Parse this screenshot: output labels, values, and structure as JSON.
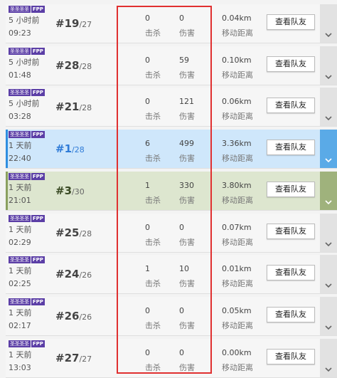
{
  "matches": [
    {
      "badge1": "圣圣圣圣",
      "badge2": "FPP",
      "time_ago": "5 小时前",
      "time": "09:23",
      "rank": "#19",
      "total": "/27",
      "kills": "0",
      "kills_label": "击杀",
      "damage": "0",
      "damage_label": "伤害",
      "distance": "0.04km",
      "distance_label": "移动距离",
      "button_label": "查看队友",
      "style": "normal"
    },
    {
      "badge1": "圣圣圣圣",
      "badge2": "FPP",
      "time_ago": "5 小时前",
      "time": "01:48",
      "rank": "#28",
      "total": "/28",
      "kills": "0",
      "kills_label": "击杀",
      "damage": "59",
      "damage_label": "伤害",
      "distance": "0.10km",
      "distance_label": "移动距离",
      "button_label": "查看队友",
      "style": "normal"
    },
    {
      "badge1": "圣圣圣圣",
      "badge2": "FPP",
      "time_ago": "5 小时前",
      "time": "03:28",
      "rank": "#21",
      "total": "/28",
      "kills": "0",
      "kills_label": "击杀",
      "damage": "121",
      "damage_label": "伤害",
      "distance": "0.06km",
      "distance_label": "移动距离",
      "button_label": "查看队友",
      "style": "normal"
    },
    {
      "badge1": "圣圣圣圣",
      "badge2": "FPP",
      "time_ago": "1 天前",
      "time": "22:40",
      "rank": "#1",
      "total": "/28",
      "kills": "6",
      "kills_label": "击杀",
      "damage": "499",
      "damage_label": "伤害",
      "distance": "3.36km",
      "distance_label": "移动距离",
      "button_label": "查看队友",
      "style": "blue"
    },
    {
      "badge1": "圣圣圣圣",
      "badge2": "FPP",
      "time_ago": "1 天前",
      "time": "21:01",
      "rank": "#3",
      "total": "/30",
      "kills": "1",
      "kills_label": "击杀",
      "damage": "330",
      "damage_label": "伤害",
      "distance": "3.80km",
      "distance_label": "移动距离",
      "button_label": "查看队友",
      "style": "green"
    },
    {
      "badge1": "圣圣圣圣",
      "badge2": "FPP",
      "time_ago": "1 天前",
      "time": "02:29",
      "rank": "#25",
      "total": "/28",
      "kills": "0",
      "kills_label": "击杀",
      "damage": "0",
      "damage_label": "伤害",
      "distance": "0.07km",
      "distance_label": "移动距离",
      "button_label": "查看队友",
      "style": "normal"
    },
    {
      "badge1": "圣圣圣圣",
      "badge2": "FPP",
      "time_ago": "1 天前",
      "time": "02:25",
      "rank": "#24",
      "total": "/26",
      "kills": "1",
      "kills_label": "击杀",
      "damage": "10",
      "damage_label": "伤害",
      "distance": "0.01km",
      "distance_label": "移动距离",
      "button_label": "查看队友",
      "style": "normal"
    },
    {
      "badge1": "圣圣圣圣",
      "badge2": "FPP",
      "time_ago": "1 天前",
      "time": "02:17",
      "rank": "#26",
      "total": "/26",
      "kills": "0",
      "kills_label": "击杀",
      "damage": "0",
      "damage_label": "伤害",
      "distance": "0.05km",
      "distance_label": "移动距离",
      "button_label": "查看队友",
      "style": "normal"
    },
    {
      "badge1": "圣圣圣圣",
      "badge2": "FPP",
      "time_ago": "1 天前",
      "time": "13:03",
      "rank": "#27",
      "total": "/27",
      "kills": "0",
      "kills_label": "击杀",
      "damage": "0",
      "damage_label": "伤害",
      "distance": "0.00km",
      "distance_label": "移动距离",
      "button_label": "查看队友",
      "style": "normal"
    }
  ],
  "icons": {
    "expand": "chevron-down-icon"
  },
  "colors": {
    "highlight": "#e03030",
    "win_row": "#cfe7fb",
    "top3_row": "#dde6cf",
    "badge": "#5b3ea6",
    "win_text": "#2f7bd7"
  }
}
